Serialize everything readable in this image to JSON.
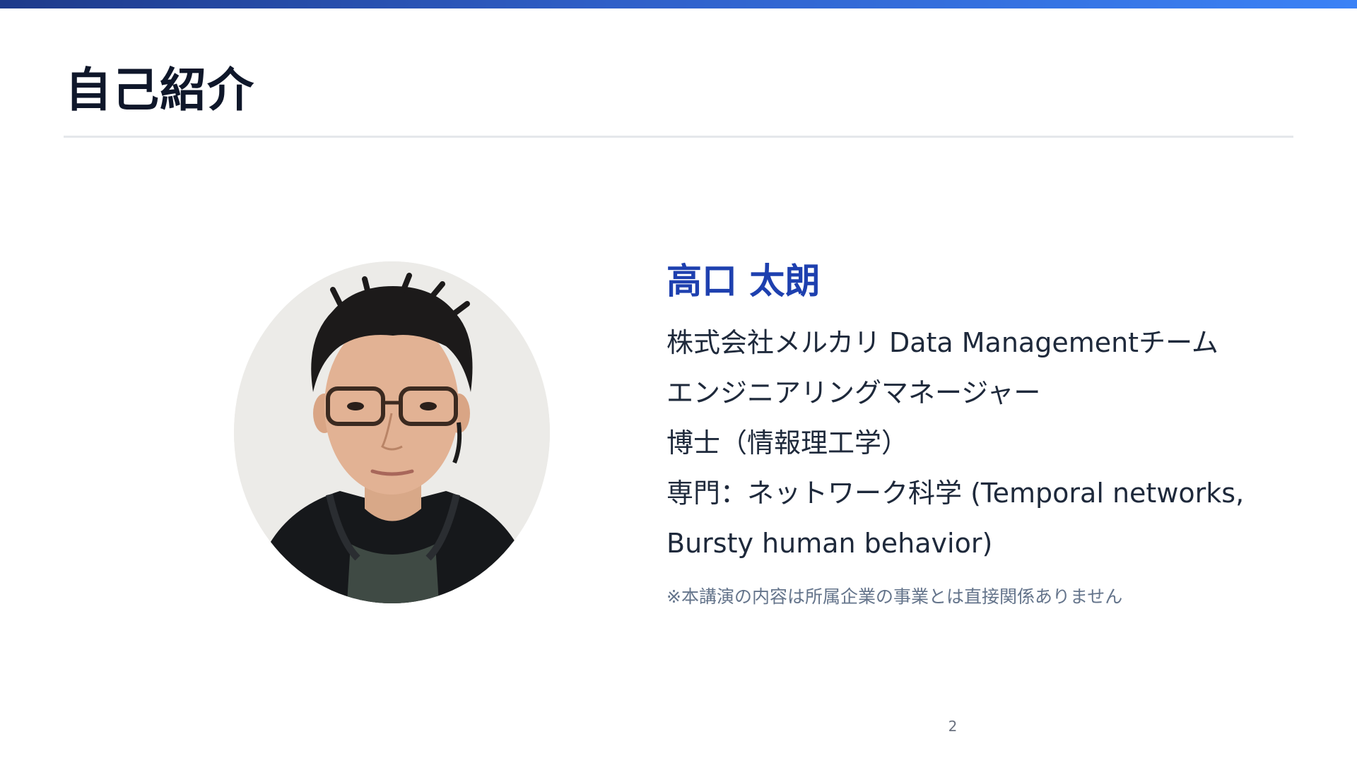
{
  "slide": {
    "title": "自己紹介",
    "page_number": "2"
  },
  "profile": {
    "name": "高口 太朗",
    "lines": [
      "株式会社メルカリ Data Managementチーム",
      " エンジニアリングマネージャー",
      "博士（情報理工学）",
      "専門：ネットワーク科学 (Temporal networks,",
      "Bursty human behavior)"
    ],
    "note": "※本講演の内容は所属企業の事業とは直接関係ありません"
  },
  "colors": {
    "accent": "#1e40af",
    "title": "#0f172a",
    "body": "#1e293b",
    "note": "#64748b",
    "bar_start": "#1e3a8a",
    "bar_end": "#3b82f6"
  },
  "icons": {
    "photo": "profile-photo-portrait"
  }
}
